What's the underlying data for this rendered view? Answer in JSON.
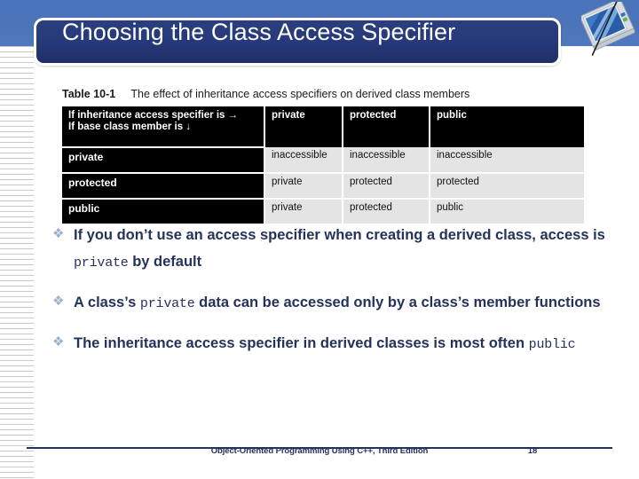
{
  "slide": {
    "title": "Choosing the Class Access Specifier",
    "bullet_glyph": "❖"
  },
  "logo": {
    "icon_name": "laptop-computer-logo"
  },
  "table": {
    "caption_label": "Table 10-1",
    "caption_text": "The effect of inheritance access specifiers on derived class members",
    "stub_line1": "If inheritance access specifier is →",
    "stub_line2": "If base class member is ↓",
    "columns": [
      "private",
      "protected",
      "public"
    ],
    "rows": [
      {
        "header": "private",
        "cells": [
          "inaccessible",
          "inaccessible",
          "inaccessible"
        ]
      },
      {
        "header": "protected",
        "cells": [
          "private",
          "protected",
          "protected"
        ]
      },
      {
        "header": "public",
        "cells": [
          "private",
          "protected",
          "public"
        ]
      }
    ]
  },
  "bullets": [
    {
      "part1": "If you don’t use an access specifier when creating a derived class, access is ",
      "code": "private",
      "part2": " by default"
    },
    {
      "part1": "A class’s ",
      "code": "private",
      "part2": " data can be accessed only by a class’s member functions"
    },
    {
      "part1": "The inheritance access specifier in derived classes is most often ",
      "code": "public",
      "part2": ""
    }
  ],
  "footer": {
    "title": "Object-Oriented Programming Using C++, Third Edition",
    "page": "18"
  },
  "colors": {
    "band_blue": "#4a74ba",
    "title_navy": "#27397a",
    "text_navy": "#24325c",
    "bullet_blue": "#9bb0cf",
    "table_black": "#000000",
    "table_cell_gray": "#e4e4e4"
  }
}
